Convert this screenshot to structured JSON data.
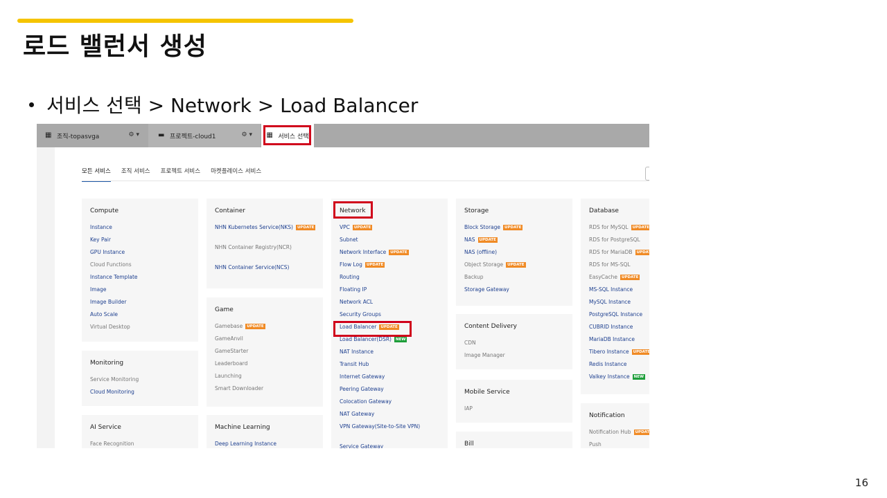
{
  "slide": {
    "title": "로드 밸런서 생성",
    "bullet": "서비스 선택 > Network > Load Balancer",
    "page_number": "16",
    "accent_color": "#f5c400",
    "highlight_color": "#d0021b"
  },
  "console": {
    "org_label": "조직-topasvga",
    "project_label": "프로젝트-cloud1",
    "service_select_label": "서비스 선택",
    "tabs": [
      "모든 서비스",
      "조직 서비스",
      "프로젝트 서비스",
      "마켓플레이스 서비스"
    ],
    "badges": {
      "update": "UPDATE",
      "new": "NEW"
    },
    "cards": {
      "compute": {
        "title": "Compute",
        "items": [
          {
            "label": "Instance",
            "style": "link"
          },
          {
            "label": "Key Pair",
            "style": "link"
          },
          {
            "label": "GPU Instance",
            "style": "link"
          },
          {
            "label": "Cloud Functions",
            "style": "gray"
          },
          {
            "label": "Instance Template",
            "style": "link"
          },
          {
            "label": "Image",
            "style": "link"
          },
          {
            "label": "Image Builder",
            "style": "link"
          },
          {
            "label": "Auto Scale",
            "style": "link"
          },
          {
            "label": "Virtual Desktop",
            "style": "gray"
          }
        ]
      },
      "monitoring": {
        "title": "Monitoring",
        "items": [
          {
            "label": "Service Monitoring",
            "style": "gray"
          },
          {
            "label": "Cloud Monitoring",
            "style": "link"
          }
        ]
      },
      "ai_service": {
        "title": "AI Service",
        "items": [
          {
            "label": "Face Recognition",
            "style": "gray"
          }
        ]
      },
      "container": {
        "title": "Container",
        "items": [
          {
            "label": "NHN Kubernetes Service(NKS)",
            "style": "link",
            "badge": "update"
          },
          {
            "label": "NHN Container Registry(NCR)",
            "style": "gray"
          },
          {
            "label": "NHN Container Service(NCS)",
            "style": "link"
          }
        ]
      },
      "game": {
        "title": "Game",
        "items": [
          {
            "label": "Gamebase",
            "style": "gray",
            "badge": "update"
          },
          {
            "label": "GameAnvil",
            "style": "gray"
          },
          {
            "label": "GameStarter",
            "style": "gray"
          },
          {
            "label": "Leaderboard",
            "style": "gray"
          },
          {
            "label": "Launching",
            "style": "gray"
          },
          {
            "label": "Smart Downloader",
            "style": "gray"
          }
        ]
      },
      "machine_learning": {
        "title": "Machine Learning",
        "items": [
          {
            "label": "Deep Learning Instance",
            "style": "link"
          }
        ]
      },
      "network": {
        "title": "Network",
        "items": [
          {
            "label": "VPC",
            "style": "link",
            "badge": "update"
          },
          {
            "label": "Subnet",
            "style": "link"
          },
          {
            "label": "Network Interface",
            "style": "link",
            "badge": "update"
          },
          {
            "label": "Flow Log",
            "style": "link",
            "badge": "update"
          },
          {
            "label": "Routing",
            "style": "link"
          },
          {
            "label": "Floating IP",
            "style": "link"
          },
          {
            "label": "Network ACL",
            "style": "link"
          },
          {
            "label": "Security Groups",
            "style": "link"
          },
          {
            "label": "Load Balancer",
            "style": "link",
            "badge": "update"
          },
          {
            "label": "Load Balancer(DSR)",
            "style": "link",
            "badge": "new"
          },
          {
            "label": "NAT Instance",
            "style": "link"
          },
          {
            "label": "Transit Hub",
            "style": "link"
          },
          {
            "label": "Internet Gateway",
            "style": "link"
          },
          {
            "label": "Peering Gateway",
            "style": "link"
          },
          {
            "label": "Colocation Gateway",
            "style": "link"
          },
          {
            "label": "NAT Gateway",
            "style": "link"
          },
          {
            "label": "VPN Gateway(Site-to-Site VPN)",
            "style": "link"
          },
          {
            "label": "Service Gateway",
            "style": "link"
          }
        ]
      },
      "storage": {
        "title": "Storage",
        "items": [
          {
            "label": "Block Storage",
            "style": "link",
            "badge": "update"
          },
          {
            "label": "NAS",
            "style": "link",
            "badge": "update"
          },
          {
            "label": "NAS (offline)",
            "style": "link"
          },
          {
            "label": "Object Storage",
            "style": "gray",
            "badge": "update"
          },
          {
            "label": "Backup",
            "style": "gray"
          },
          {
            "label": "Storage Gateway",
            "style": "link"
          }
        ]
      },
      "content_delivery": {
        "title": "Content Delivery",
        "items": [
          {
            "label": "CDN",
            "style": "gray"
          },
          {
            "label": "Image Manager",
            "style": "gray"
          }
        ]
      },
      "mobile_service": {
        "title": "Mobile Service",
        "items": [
          {
            "label": "IAP",
            "style": "gray"
          }
        ]
      },
      "bill": {
        "title": "Bill",
        "items": []
      },
      "database": {
        "title": "Database",
        "items": [
          {
            "label": "RDS for MySQL",
            "style": "gray",
            "badge": "update"
          },
          {
            "label": "RDS for PostgreSQL",
            "style": "gray"
          },
          {
            "label": "RDS for MariaDB",
            "style": "gray",
            "badge": "update"
          },
          {
            "label": "RDS for MS-SQL",
            "style": "gray"
          },
          {
            "label": "EasyCache",
            "style": "gray",
            "badge": "update"
          },
          {
            "label": "MS-SQL Instance",
            "style": "link"
          },
          {
            "label": "MySQL Instance",
            "style": "link"
          },
          {
            "label": "PostgreSQL Instance",
            "style": "link"
          },
          {
            "label": "CUBRID Instance",
            "style": "link"
          },
          {
            "label": "MariaDB Instance",
            "style": "link"
          },
          {
            "label": "Tibero Instance",
            "style": "link",
            "badge": "update"
          },
          {
            "label": "Redis Instance",
            "style": "link"
          },
          {
            "label": "Valkey Instance",
            "style": "link",
            "badge": "new"
          }
        ]
      },
      "notification": {
        "title": "Notification",
        "items": [
          {
            "label": "Notification Hub",
            "style": "gray",
            "badge": "update"
          },
          {
            "label": "Push",
            "style": "gray"
          }
        ]
      }
    }
  }
}
